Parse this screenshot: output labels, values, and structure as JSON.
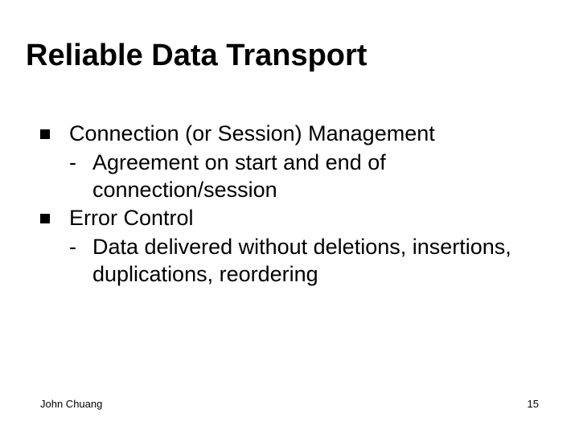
{
  "title": "Reliable Data Transport",
  "bullets": [
    {
      "text": "Connection (or Session) Management",
      "sub": [
        "Agreement on start and end of connection/session"
      ]
    },
    {
      "text": "Error Control",
      "sub": [
        "Data delivered without deletions, insertions, duplications, reordering"
      ]
    }
  ],
  "footer": {
    "author": "John Chuang",
    "page": "15"
  }
}
